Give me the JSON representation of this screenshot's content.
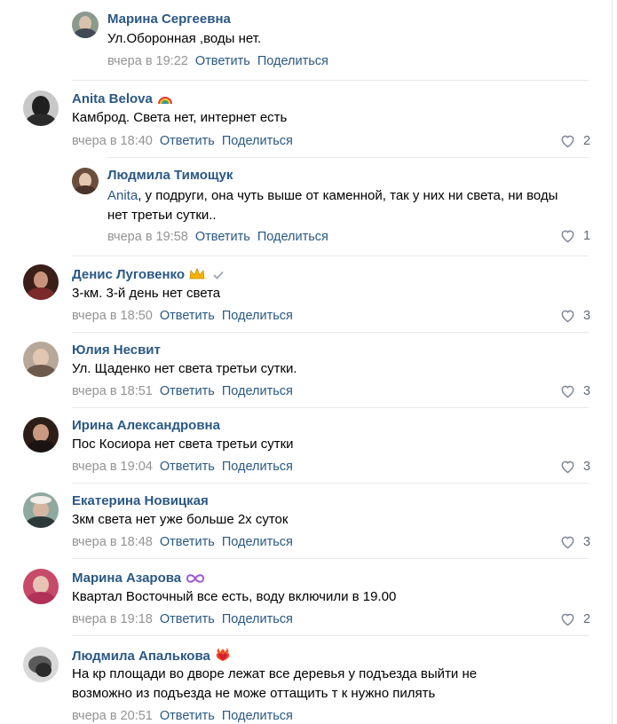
{
  "comments": [
    {
      "name": "Марина Сергеевна",
      "text": "Ул.Оборонная ,воды нет.",
      "date": "вчера в 19:22",
      "reply": "Ответить",
      "share": "Поделиться",
      "likes": ""
    },
    {
      "name": "Anita Belova",
      "text": "Камброд. Света нет, интернет есть",
      "date": "вчера в 18:40",
      "reply": "Ответить",
      "share": "Поделиться",
      "likes": "2"
    },
    {
      "name": "Людмила Тимощук",
      "mention": "Anita",
      "text": ", у подруги, она чуть выше от каменной, так у них ни света, ни воды нет третьи сутки..",
      "date": "вчера в 19:58",
      "reply": "Ответить",
      "share": "Поделиться",
      "likes": "1"
    },
    {
      "name": "Денис Луговенко",
      "text": "3-км. 3-й день нет света",
      "date": "вчера в 18:50",
      "reply": "Ответить",
      "share": "Поделиться",
      "likes": "3"
    },
    {
      "name": "Юлия Несвит",
      "text": "Ул. Щаденко нет света третьи сутки.",
      "date": "вчера в 18:51",
      "reply": "Ответить",
      "share": "Поделиться",
      "likes": "3"
    },
    {
      "name": "Ирина Александровна",
      "text": "Пос Косиора нет света третьи сутки",
      "date": "вчера в 19:04",
      "reply": "Ответить",
      "share": "Поделиться",
      "likes": "3"
    },
    {
      "name": "Екатерина Новицкая",
      "text": "3км света нет уже больше 2х суток",
      "date": "вчера в 18:48",
      "reply": "Ответить",
      "share": "Поделиться",
      "likes": "3"
    },
    {
      "name": "Марина Азарова",
      "text": "Квартал Восточный все есть, воду включили в 19.00",
      "date": "вчера в 19:18",
      "reply": "Ответить",
      "share": "Поделиться",
      "likes": "2"
    },
    {
      "name": "Людмила Апалькова",
      "text": "На кр площади во дворе лежат все деревья у подъезда выйти не возможно из подъезда не може оттащить т к нужно пилять",
      "date": "вчера в 20:51",
      "reply": "Ответить",
      "share": "Поделиться",
      "likes": ""
    }
  ],
  "colors": {
    "link": "#2a5885",
    "meta": "#939393",
    "like": "#626d7a",
    "separator": "#e7e8ec"
  },
  "icons": {
    "like": "heart-outline-icon",
    "verified": "check-icon",
    "rainbow": "rainbow-icon",
    "crown": "crown-icon",
    "infinity": "infinity-icon",
    "heart": "flaming-heart-icon"
  }
}
